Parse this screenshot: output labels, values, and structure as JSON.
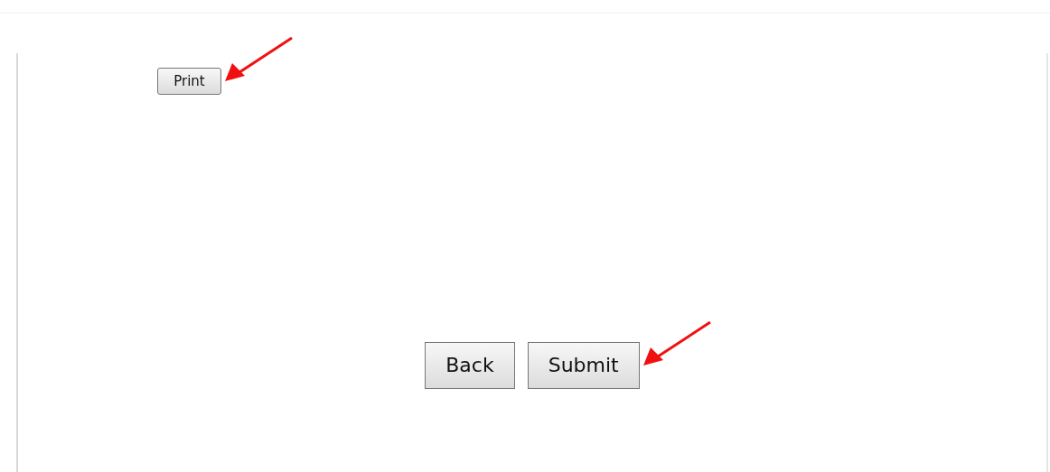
{
  "top_buttons": [
    {
      "label": "Print",
      "pointed": true
    }
  ],
  "bottom_buttons": [
    {
      "label": "Back",
      "pointed": false
    },
    {
      "label": "Submit",
      "pointed": true
    }
  ]
}
